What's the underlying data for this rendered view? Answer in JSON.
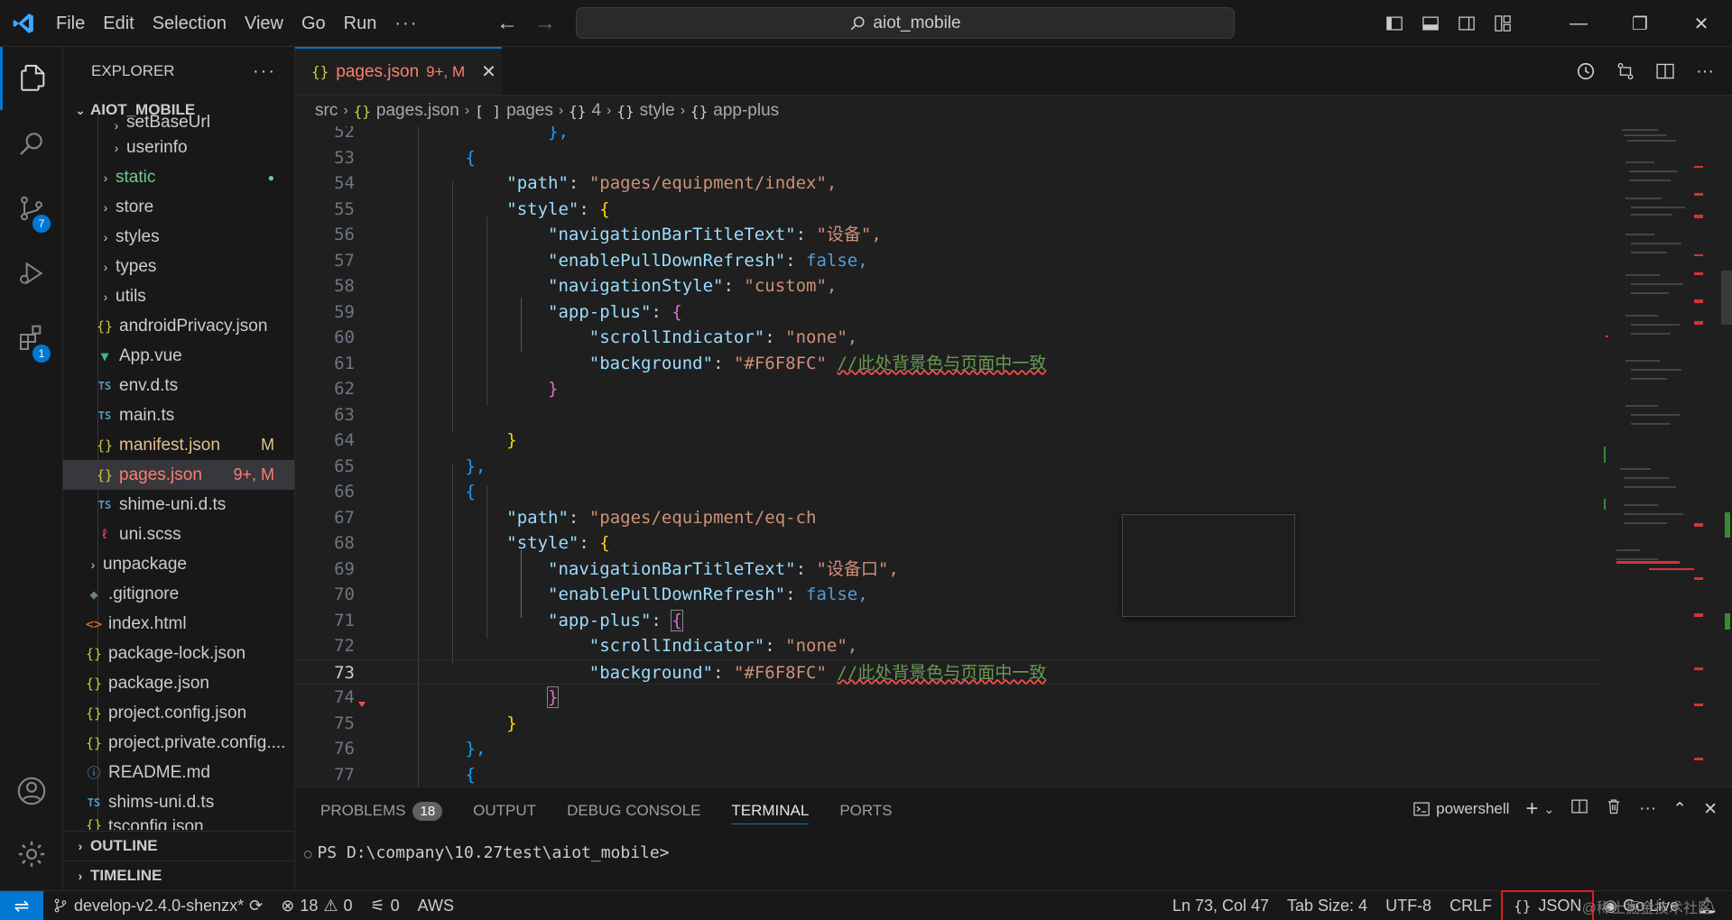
{
  "titlebar": {
    "menu": [
      "File",
      "Edit",
      "Selection",
      "View",
      "Go",
      "Run",
      "···"
    ],
    "search_text": "aiot_mobile"
  },
  "activity": {
    "scm_badge": "7",
    "extensions_badge": "1"
  },
  "sidebar": {
    "title": "EXPLORER",
    "more": "···",
    "root": "AIOT_MOBILE",
    "items": [
      {
        "label": "setBaseUrl",
        "icon": "chevron",
        "indent": 2
      },
      {
        "label": "userinfo",
        "icon": "chevron",
        "indent": 2
      },
      {
        "label": "static",
        "icon": "chevron",
        "indent": 1,
        "decoration": "●"
      },
      {
        "label": "store",
        "icon": "chevron",
        "indent": 1
      },
      {
        "label": "styles",
        "icon": "chevron",
        "indent": 1
      },
      {
        "label": "types",
        "icon": "chevron",
        "indent": 1
      },
      {
        "label": "utils",
        "icon": "chevron",
        "indent": 1
      },
      {
        "label": "androidPrivacy.json",
        "icon": "json",
        "indent": 1
      },
      {
        "label": "App.vue",
        "icon": "vue",
        "indent": 1
      },
      {
        "label": "env.d.ts",
        "icon": "ts",
        "indent": 1
      },
      {
        "label": "main.ts",
        "icon": "ts",
        "indent": 1
      },
      {
        "label": "manifest.json",
        "icon": "json",
        "indent": 1,
        "decoration": "M"
      },
      {
        "label": "pages.json",
        "icon": "json",
        "indent": 1,
        "decoration": "9+, M"
      },
      {
        "label": "shime-uni.d.ts",
        "icon": "ts",
        "indent": 1
      },
      {
        "label": "uni.scss",
        "icon": "scss",
        "indent": 1
      },
      {
        "label": "unpackage",
        "icon": "chevron",
        "indent": 0
      },
      {
        "label": ".gitignore",
        "icon": "git",
        "indent": 0
      },
      {
        "label": "index.html",
        "icon": "html",
        "indent": 0
      },
      {
        "label": "package-lock.json",
        "icon": "json",
        "indent": 0
      },
      {
        "label": "package.json",
        "icon": "json",
        "indent": 0
      },
      {
        "label": "project.config.json",
        "icon": "json",
        "indent": 0
      },
      {
        "label": "project.private.config....",
        "icon": "json",
        "indent": 0
      },
      {
        "label": "README.md",
        "icon": "info",
        "indent": 0
      },
      {
        "label": "shims-uni.d.ts",
        "icon": "ts",
        "indent": 0
      },
      {
        "label": "tsconfig.json",
        "icon": "json",
        "indent": 0
      }
    ],
    "outline": "OUTLINE",
    "timeline": "TIMELINE"
  },
  "editor": {
    "tab": {
      "name": "pages.json",
      "status": "9+, M",
      "icon": "{}"
    },
    "breadcrumb": [
      "src",
      "pages.json",
      "pages",
      "4",
      "style",
      "app-plus"
    ],
    "breadcrumb_icons": [
      "",
      "{}",
      "[ ]",
      "{}",
      "{}",
      "{}"
    ],
    "lines": [
      {
        "n": "52",
        "text": "},"
      },
      {
        "n": "53",
        "text": "{"
      },
      {
        "n": "54",
        "key": "\"path\"",
        "value": "\"pages/equipment/index\","
      },
      {
        "n": "55",
        "key": "\"style\"",
        "value": "{"
      },
      {
        "n": "56",
        "key": "\"navigationBarTitleText\"",
        "value": "\"设备\","
      },
      {
        "n": "57",
        "key": "\"enablePullDownRefresh\"",
        "value": "false,"
      },
      {
        "n": "58",
        "key": "\"navigationStyle\"",
        "value": "\"custom\","
      },
      {
        "n": "59",
        "key": "\"app-plus\"",
        "value": "{"
      },
      {
        "n": "60",
        "key": "\"scrollIndicator\"",
        "value": "\"none\","
      },
      {
        "n": "61",
        "key": "\"background\"",
        "value": "\"#F6F8FC\"",
        "comment": "//此处背景色与页面中一致"
      },
      {
        "n": "62",
        "text": "}"
      },
      {
        "n": "63",
        "text": ""
      },
      {
        "n": "64",
        "text": "}"
      },
      {
        "n": "65",
        "text": "},"
      },
      {
        "n": "66",
        "text": "{"
      },
      {
        "n": "67",
        "key": "\"path\"",
        "value": "\"pages/equipment/eq-ch"
      },
      {
        "n": "68",
        "key": "\"style\"",
        "value": "{"
      },
      {
        "n": "69",
        "key": "\"navigationBarTitleText\"",
        "value": "\"设备口\","
      },
      {
        "n": "70",
        "key": "\"enablePullDownRefresh\"",
        "value": "false,"
      },
      {
        "n": "71",
        "key": "\"app-plus\"",
        "value": "{"
      },
      {
        "n": "72",
        "key": "\"scrollIndicator\"",
        "value": "\"none\","
      },
      {
        "n": "73",
        "key": "\"background\"",
        "value": "\"#F6F8FC\"",
        "comment": "//此处背景色与页面中一致"
      },
      {
        "n": "74",
        "text": "}"
      },
      {
        "n": "75",
        "text": "}"
      },
      {
        "n": "76",
        "text": "},"
      },
      {
        "n": "77",
        "text": "{"
      }
    ]
  },
  "panel": {
    "tabs": [
      "PROBLEMS",
      "OUTPUT",
      "DEBUG CONSOLE",
      "TERMINAL",
      "PORTS"
    ],
    "problems_count": "18",
    "shell": "powershell",
    "prompt": "PS D:\\company\\10.27test\\aiot_mobile>"
  },
  "statusbar": {
    "branch": "develop-v2.4.0-shenzx*",
    "errors": "18",
    "warnings": "0",
    "ports": "0",
    "aws": "AWS",
    "position": "Ln 73, Col 47",
    "tab_size": "Tab Size: 4",
    "encoding": "UTF-8",
    "eol": "CRLF",
    "language": "JSON",
    "golive": "Go Live",
    "watermark": "@稀土掘金技术社区"
  },
  "colors": {
    "accent": "#0078d4",
    "error_text": "#f88070",
    "modified_text": "#e2c08d",
    "highlight_box": "#e0191f"
  }
}
